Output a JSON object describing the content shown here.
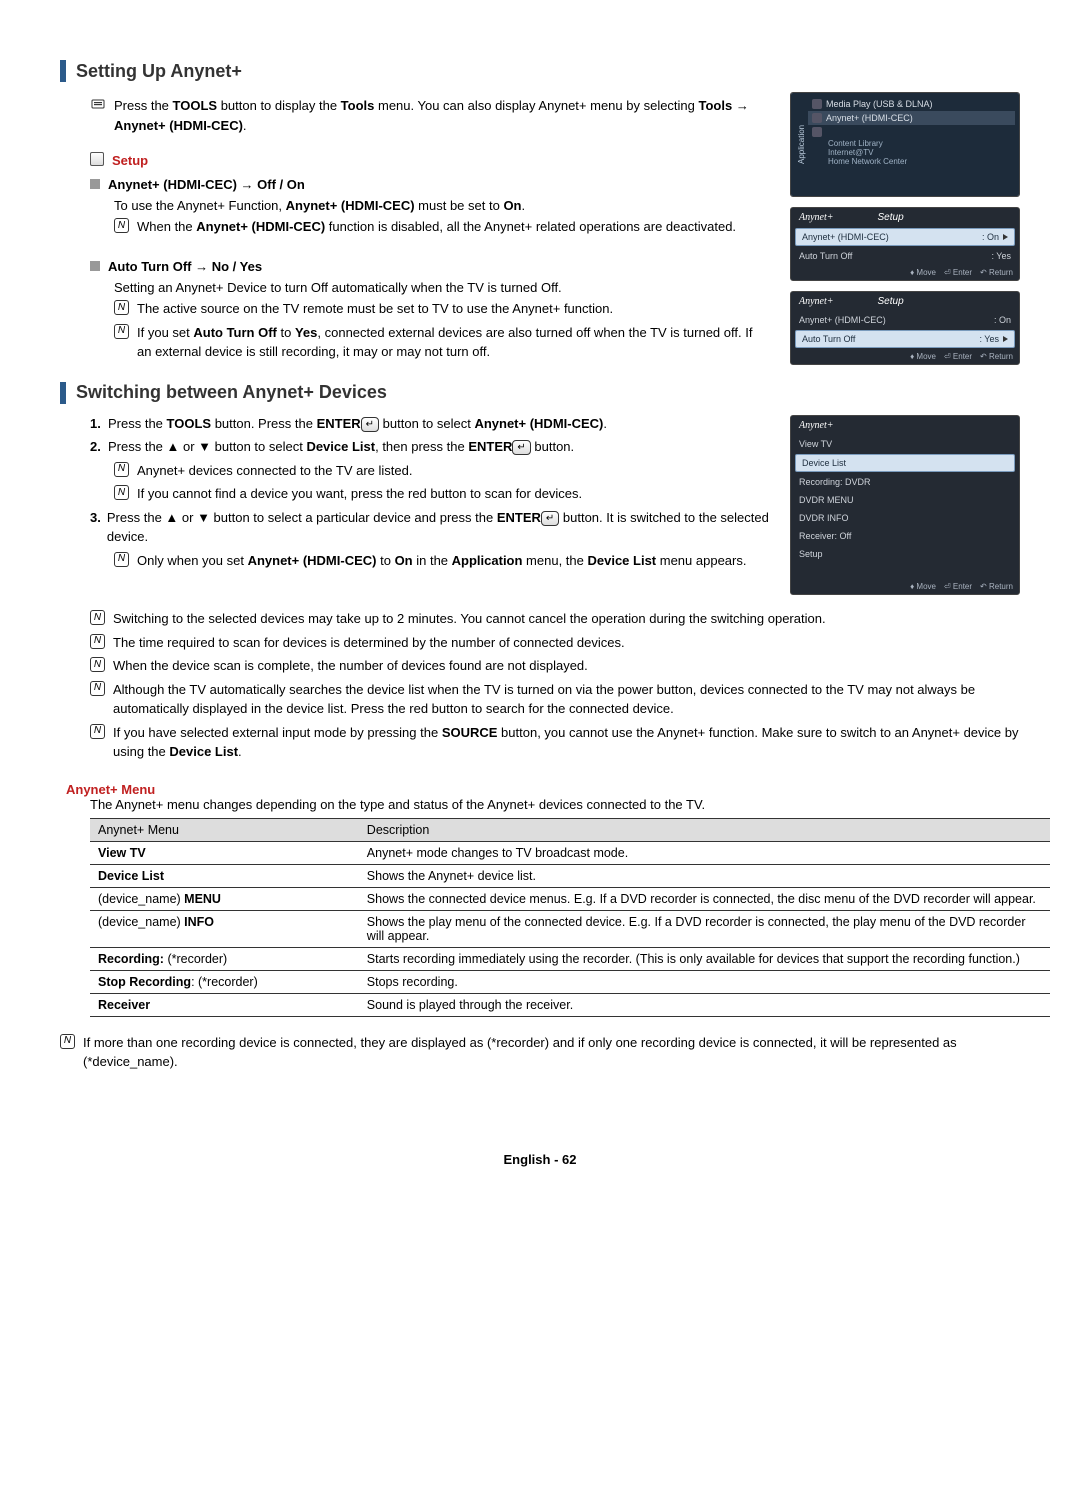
{
  "sections": {
    "setting_up": {
      "title": "Setting Up Anynet+",
      "intro_part1": "Press the ",
      "intro_bold1": "TOOLS",
      "intro_part2": " button to display the ",
      "intro_bold2": "Tools",
      "intro_part3": " menu. You can also display Anynet+ menu by selecting ",
      "intro_bold3": "Tools → Anynet+ (HDMI-CEC)",
      "intro_part4": ".",
      "setup_label": "Setup",
      "item1_title": "Anynet+ (HDMI-CEC) → Off / On",
      "item1_line_a": "To use the Anynet+ Function, ",
      "item1_line_a_bold1": "Anynet+ (HDMI-CEC)",
      "item1_line_a_mid": " must be set to ",
      "item1_line_a_bold2": "On",
      "item1_line_a_end": ".",
      "item1_note_a": "When the ",
      "item1_note_a_bold": "Anynet+ (HDMI-CEC)",
      "item1_note_a_end": " function is disabled, all the Anynet+ related operations are deactivated.",
      "item2_title": "Auto Turn Off → No / Yes",
      "item2_line": "Setting an Anynet+ Device to turn Off automatically when the TV is turned Off.",
      "item2_note1": "The active source on the TV remote must be set to TV to use the Anynet+ function.",
      "item2_note2_a": "If you set ",
      "item2_note2_bold1": "Auto Turn Off",
      "item2_note2_b": " to ",
      "item2_note2_bold2": "Yes",
      "item2_note2_c": ", connected external devices are also turned off when the TV is turned off. If an external device is still recording, it may or may not turn off."
    },
    "switching": {
      "title": "Switching between Anynet+ Devices",
      "step1_a": "Press the ",
      "step1_b1": "TOOLS",
      "step1_b": " button. Press the ",
      "step1_b2": "ENTER",
      "step1_c": " button to select ",
      "step1_b3": "Anynet+ (HDMI-CEC)",
      "step1_d": ".",
      "step2_a": "Press the ▲ or ▼ button to select ",
      "step2_b1": "Device List",
      "step2_b": ", then press the ",
      "step2_b2": "ENTER",
      "step2_c": " button.",
      "step2_note1": "Anynet+ devices connected to the TV are listed.",
      "step2_note2": "If you cannot find a device you want, press the red button to scan for devices.",
      "step3_a": "Press the ▲ or ▼ button to select a particular device and press the ",
      "step3_b1": "ENTER",
      "step3_b": " button. It is switched to the selected device.",
      "step3_note_a": "Only when you set ",
      "step3_note_b1": "Anynet+ (HDMI-CEC)",
      "step3_note_b": " to ",
      "step3_note_b2": "On",
      "step3_note_c": " in the ",
      "step3_note_b3": "Application",
      "step3_note_d": " menu, the ",
      "step3_note_b4": "Device List",
      "step3_note_e": " menu appears.",
      "notes": [
        "Switching to the selected devices may take up to 2 minutes. You cannot cancel the operation during the switching operation.",
        "The time required to scan for devices is determined by the number of connected devices.",
        "When the device scan is complete, the number of devices found are not displayed.",
        "Although the TV automatically searches the device list when the TV is turned on via the power button, devices connected to the TV may not always be automatically displayed in the device list. Press the red button to search for the connected device."
      ],
      "note_source_a": "If you have selected external input mode by pressing the ",
      "note_source_b1": "SOURCE",
      "note_source_b": " button, you cannot use the Anynet+ function. Make sure to switch to an Anynet+ device by using the ",
      "note_source_b2": "Device List",
      "note_source_c": "."
    },
    "anynet_menu": {
      "title": "Anynet+ Menu",
      "intro": "The Anynet+ menu changes depending on the type and status of the Anynet+ devices connected to the TV.",
      "headers": {
        "col1": "Anynet+ Menu",
        "col2": "Description"
      },
      "rows": [
        {
          "c1_bold": "View TV",
          "c1_rest": "",
          "c2": "Anynet+ mode changes to TV broadcast mode."
        },
        {
          "c1_bold": "Device List",
          "c1_rest": "",
          "c2": "Shows the Anynet+ device list."
        },
        {
          "c1_pre": "(device_name) ",
          "c1_bold": "MENU",
          "c2": "Shows the connected device menus. E.g. If a DVD recorder is connected, the disc menu of the DVD recorder will appear."
        },
        {
          "c1_pre": "(device_name) ",
          "c1_bold": "INFO",
          "c2": "Shows the play menu of the connected device. E.g. If a DVD recorder is connected, the play menu of the DVD recorder will appear."
        },
        {
          "c1_bold": "Recording:",
          "c1_rest": " (*recorder)",
          "c2": "Starts recording immediately using the recorder. (This is only available for devices that support the recording function.)"
        },
        {
          "c1_bold": "Stop Recording",
          "c1_rest": ": (*recorder)",
          "c2": "Stops recording."
        },
        {
          "c1_bold": "Receiver",
          "c1_rest": "",
          "c2": "Sound is played through the receiver."
        }
      ],
      "footnote": "If more than one recording device is connected, they are displayed as (*recorder) and if only one recording device is connected, it will be represented as (*device_name)."
    }
  },
  "osd": {
    "app_menu": {
      "side_label": "Application",
      "items": [
        "Media Play (USB & DLNA)",
        "Anynet+ (HDMI-CEC)",
        "Content Library",
        "Internet@TV",
        "Home Network Center"
      ],
      "active_index": 1
    },
    "setup1": {
      "logo": "Anynet+",
      "title": "Setup",
      "row1": {
        "label": "Anynet+ (HDMI-CEC)",
        "value": ": On"
      },
      "row2": {
        "label": "Auto Turn Off",
        "value": ": Yes"
      },
      "footer": {
        "move": "Move",
        "enter": "Enter",
        "return": "Return"
      },
      "selected": 0
    },
    "setup2": {
      "logo": "Anynet+",
      "title": "Setup",
      "row1": {
        "label": "Anynet+ (HDMI-CEC)",
        "value": ": On"
      },
      "row2": {
        "label": "Auto Turn Off",
        "value": ": Yes"
      },
      "footer": {
        "move": "Move",
        "enter": "Enter",
        "return": "Return"
      },
      "selected": 1
    },
    "devlist": {
      "logo": "Anynet+",
      "items": [
        "View TV",
        "Device List",
        "Recording: DVDR",
        "DVDR MENU",
        "DVDR INFO",
        "Receiver: Off",
        "Setup"
      ],
      "selected": 1,
      "footer": {
        "move": "Move",
        "enter": "Enter",
        "return": "Return"
      }
    }
  },
  "enter_glyph": "↵",
  "footer": "English - 62"
}
